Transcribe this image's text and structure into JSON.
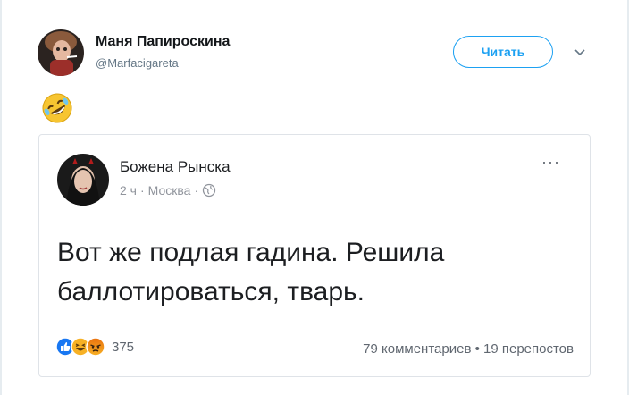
{
  "tweet": {
    "author_name": "Маня Папироскина",
    "author_handle": "@Marfacigareta",
    "follow_label": "Читать",
    "emoji": "rolling-on-the-floor-laughing-emoji"
  },
  "quoted_post": {
    "author_name": "Божена Рынска",
    "time": "2 ч",
    "separator": "·",
    "location": "Москва",
    "text": "Вот же подлая гадина. Решила баллотироваться, тварь.",
    "more_label": "···",
    "reaction_icons": [
      "like-reaction-icon",
      "haha-reaction-icon",
      "angry-reaction-icon"
    ],
    "reaction_count": "375",
    "comments": "79 комментариев",
    "shares": "19 перепостов"
  },
  "colors": {
    "accent": "#1da1f2",
    "like": "#1877f2",
    "haha": "#f7b125",
    "angry": "#e9710f"
  }
}
